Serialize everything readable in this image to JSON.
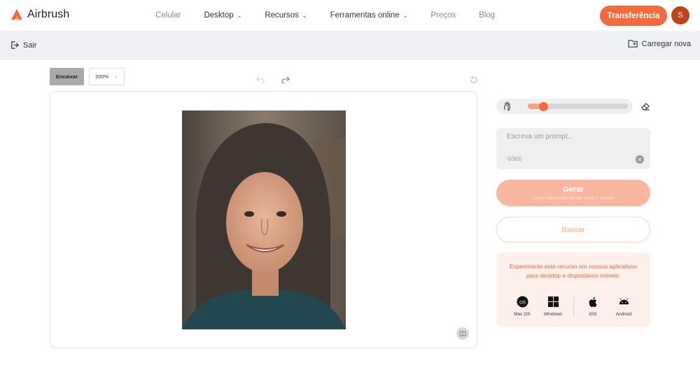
{
  "brand": {
    "name": "Airbrush",
    "accent": "#f36b3d"
  },
  "nav": {
    "items": [
      {
        "label": "Celular",
        "dropdown": false,
        "muted": true
      },
      {
        "label": "Desktop",
        "dropdown": true,
        "muted": false
      },
      {
        "label": "Recursos",
        "dropdown": true,
        "muted": false
      },
      {
        "label": "Ferramentas online",
        "dropdown": true,
        "muted": false
      },
      {
        "label": "Preços",
        "dropdown": false,
        "muted": true
      },
      {
        "label": "Blog",
        "dropdown": false,
        "muted": true
      }
    ],
    "cta_label": "Transferência",
    "avatar_initial": "S"
  },
  "subbar": {
    "exit_label": "Sair",
    "upload_label": "Carregar nova"
  },
  "editor": {
    "fit_label": "Encaixar",
    "zoom_label": "200%"
  },
  "panel": {
    "brush_size_fraction": 0.12,
    "prompt_placeholder": "Escreva um prompt...",
    "prompt_value": "",
    "counter": "0/300",
    "generate_label": "Gerar",
    "generate_sub": "Cada exportação de foto custa 1 crédito",
    "download_label": "Baixar",
    "promo_text": "Experimente este recurso em nossos aplicativos para desktop e dispositivos móveis.",
    "apps": [
      {
        "label": "Mac OS",
        "icon": "macos-icon"
      },
      {
        "label": "Windows",
        "icon": "windows-icon"
      },
      {
        "label": "iOS",
        "icon": "apple-icon"
      },
      {
        "label": "Android",
        "icon": "android-icon"
      }
    ]
  }
}
